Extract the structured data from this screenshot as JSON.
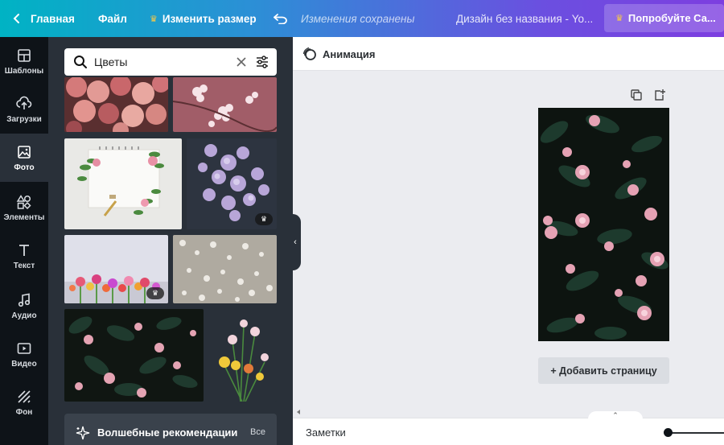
{
  "topbar": {
    "home_label": "Главная",
    "file_label": "Файл",
    "resize_label": "Изменить размер",
    "saved_status": "Изменения сохранены",
    "design_title": "Дизайн без названия - Yo...",
    "try_label": "Попробуйте Са..."
  },
  "rail": {
    "items": [
      {
        "label": "Шаблоны",
        "icon": "templates-icon"
      },
      {
        "label": "Загрузки",
        "icon": "upload-icon"
      },
      {
        "label": "Фото",
        "icon": "photo-icon"
      },
      {
        "label": "Элементы",
        "icon": "elements-icon"
      },
      {
        "label": "Текст",
        "icon": "text-icon"
      },
      {
        "label": "Аудио",
        "icon": "audio-icon"
      },
      {
        "label": "Видео",
        "icon": "video-icon"
      },
      {
        "label": "Фон",
        "icon": "background-icon"
      }
    ]
  },
  "search": {
    "value": "Цветы"
  },
  "magic": {
    "label": "Волшебные рекомендации",
    "all_label": "Все"
  },
  "editor": {
    "animation_label": "Анимация",
    "add_page_label": "+ Добавить страницу",
    "notes_label": "Заметки"
  },
  "colors": {
    "gradient_start": "#00b3c4",
    "gradient_end": "#7d3ee0",
    "rail_bg": "#0e1318",
    "panel_bg": "#293039",
    "crown": "#f7c948"
  }
}
